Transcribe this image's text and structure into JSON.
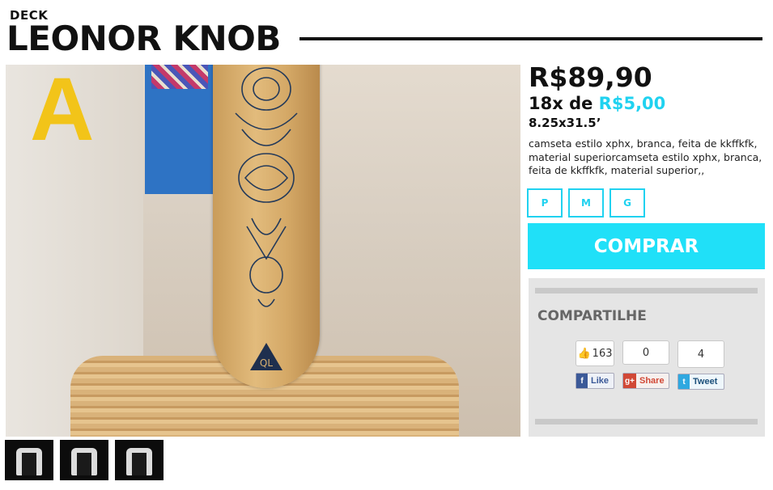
{
  "product": {
    "category": "DECK",
    "name": "LEONOR KNOB",
    "price": "R$89,90",
    "installments_prefix": "18x de",
    "installments_value": "R$5,00",
    "dimensions": "8.25x31.5’",
    "description": "camseta estilo xphx, branca, feita de kkffkfk, material superiorcamseta estilo xphx, branca, feita de kkffkfk, material superior,,"
  },
  "sizes": [
    "P",
    "M",
    "G"
  ],
  "buy_label": "COMPRAR",
  "share": {
    "title": "COMPARTILHE",
    "facebook_count": "163",
    "facebook_label": "Like",
    "gplus_count": "0",
    "gplus_label": "Share",
    "twitter_count": "4",
    "twitter_label": "Tweet"
  },
  "colors": {
    "accent": "#20d2f0",
    "buy_button": "#20e0f8",
    "share_panel": "#e5e5e5"
  },
  "icons": [
    "facebook-like-icon",
    "facebook-icon",
    "google-plus-icon",
    "twitter-icon",
    "deck-logo-icon"
  ]
}
